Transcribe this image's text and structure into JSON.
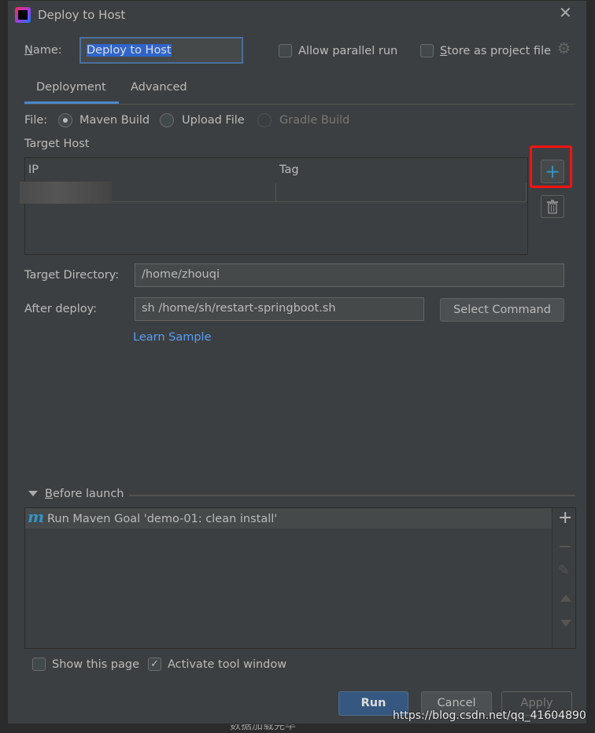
{
  "window": {
    "title": "Deploy to Host",
    "close_icon": "close-icon",
    "app_icon": "intellij-icon"
  },
  "name": {
    "label": "Name:",
    "value": "Deploy to Host"
  },
  "options": {
    "allow_parallel_run": {
      "label": "Allow parallel run",
      "checked": false
    },
    "store_as_project_file": {
      "label": "Store as project file",
      "checked": false
    }
  },
  "tabs": [
    {
      "label": "Deployment",
      "active": true
    },
    {
      "label": "Advanced",
      "active": false
    }
  ],
  "file": {
    "label": "File:",
    "options": [
      {
        "label": "Maven Build",
        "selected": true,
        "enabled": true
      },
      {
        "label": "Upload File",
        "selected": false,
        "enabled": true
      },
      {
        "label": "Gradle Build",
        "selected": false,
        "enabled": false
      }
    ]
  },
  "target_host": {
    "label": "Target Host",
    "columns": [
      "IP",
      "Tag"
    ],
    "rows": [
      [
        "",
        ""
      ]
    ]
  },
  "target_directory": {
    "label": "Target Directory:",
    "value": "/home/zhouqi"
  },
  "after_deploy": {
    "label": "After deploy:",
    "value": "sh /home/sh/restart-springboot.sh",
    "select_command": "Select Command"
  },
  "learn_sample": "Learn Sample",
  "before_launch": {
    "label": "Before launch",
    "items": [
      "Run Maven Goal 'demo-01: clean install'"
    ]
  },
  "footer": {
    "show_this_page": {
      "label": "Show this page",
      "checked": false
    },
    "activate_tool_window": {
      "label": "Activate tool window",
      "checked": true
    }
  },
  "buttons": {
    "run": "Run",
    "cancel": "Cancel",
    "apply": "Apply"
  },
  "watermark": "https://blog.csdn.net/qq_41604890",
  "background_status": "数据加载完毕",
  "colors": {
    "accent": "#4a88c7",
    "primary_button": "#365880",
    "link": "#589df6",
    "highlight_box": "#ff0000"
  }
}
